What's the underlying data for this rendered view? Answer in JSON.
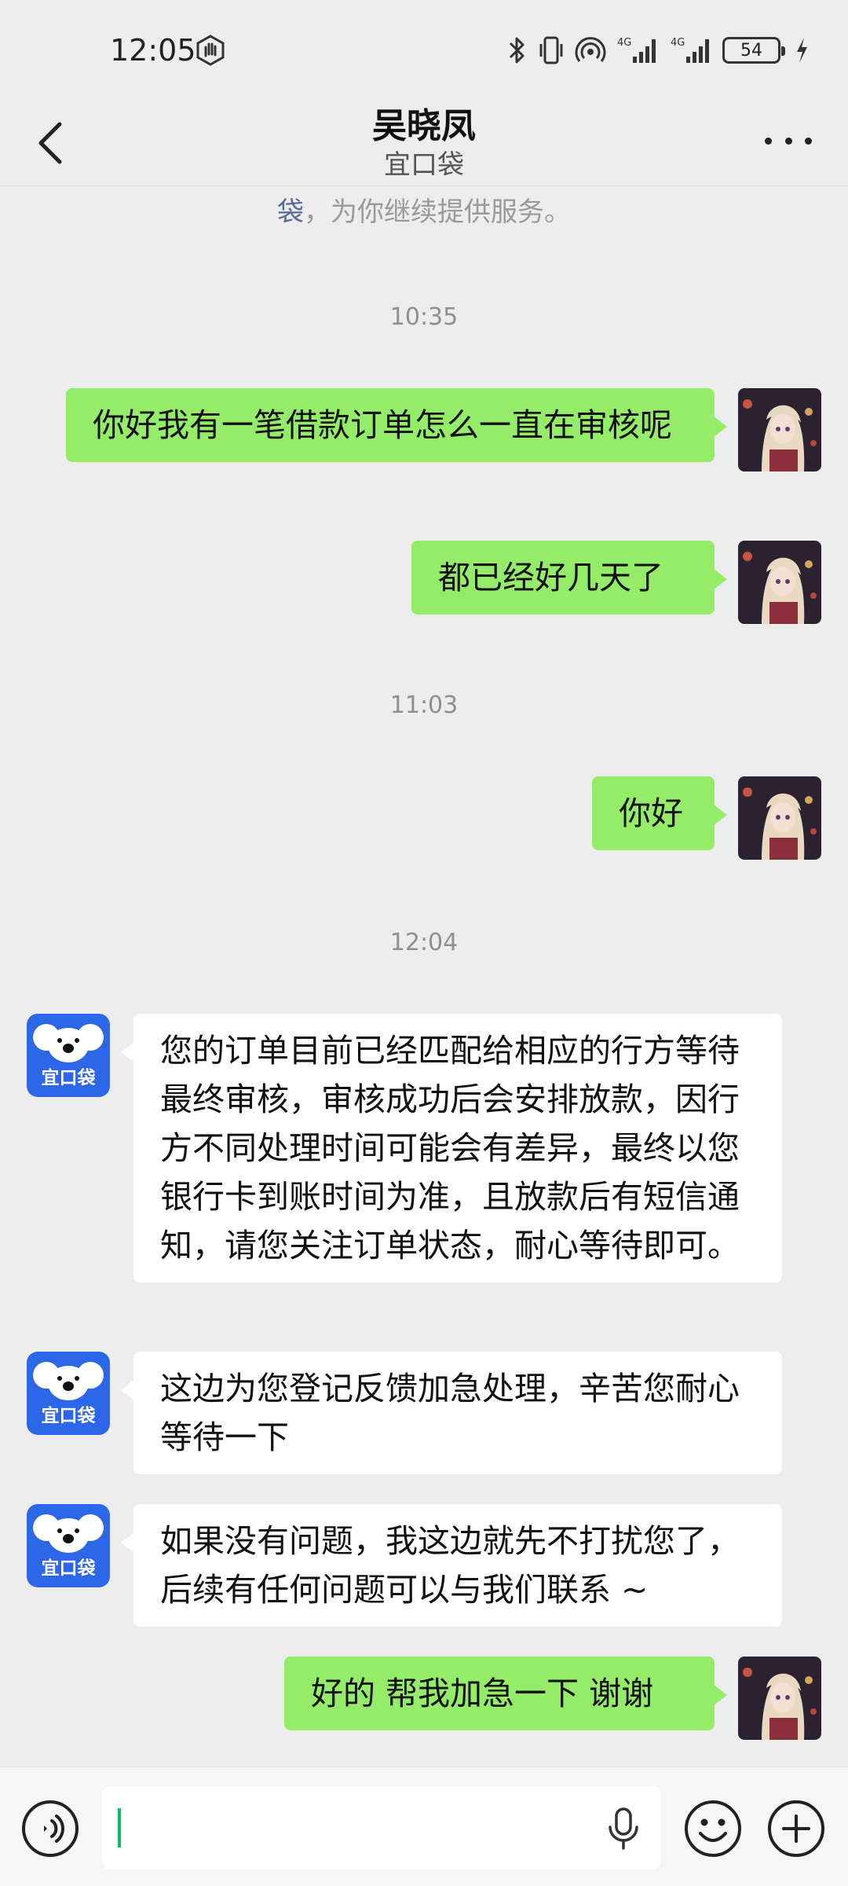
{
  "status_bar": {
    "time": "12:05",
    "battery": "54",
    "icons": [
      "hand-icon",
      "bluetooth-icon",
      "vibrate-icon",
      "hotspot-icon",
      "signal-4g-icon",
      "signal-4g-icon",
      "battery-icon",
      "charging-icon"
    ]
  },
  "header": {
    "title": "吴晓凤",
    "subtitle": "宜口袋"
  },
  "chat": {
    "system_link": "袋",
    "system_rest": "，为你继续提供服务。",
    "messages": [
      {
        "type": "time",
        "text": "10:35"
      },
      {
        "type": "me",
        "text": "你好我有一笔借款订单怎么一直在审核呢"
      },
      {
        "type": "me",
        "text": "都已经好几天了"
      },
      {
        "type": "time",
        "text": "11:03"
      },
      {
        "type": "me",
        "text": "你好"
      },
      {
        "type": "time",
        "text": "12:04"
      },
      {
        "type": "them",
        "text": "您的订单目前已经匹配给相应的行方等待最终审核，审核成功后会安排放款，因行方不同处理时间可能会有差异，最终以您银行卡到账时间为准，且放款后有短信通知，请您关注订单状态，耐心等待即可。"
      },
      {
        "type": "them",
        "text": "这边为您登记反馈加急处理，辛苦您耐心等待一下"
      },
      {
        "type": "them",
        "text": "如果没有问题，我这边就先不打扰您了，后续有任何问题可以与我们联系 ~"
      },
      {
        "type": "me",
        "text": "好的 帮我加急一下 谢谢"
      }
    ],
    "agent_avatar_label": "宜口袋"
  },
  "colors": {
    "background": "#ededed",
    "my_bubble": "#95ec69",
    "their_bubble": "#ffffff",
    "link": "#576b95",
    "caret": "#07c160",
    "agent_avatar": "#2c67e8"
  }
}
